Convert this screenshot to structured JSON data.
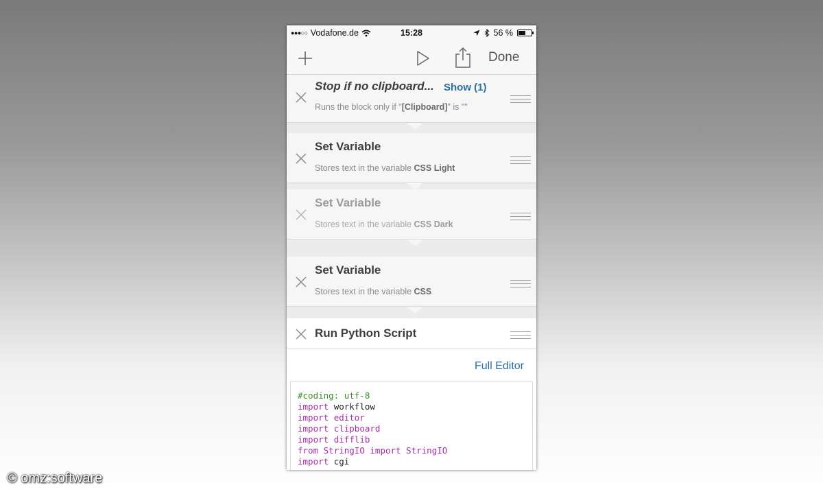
{
  "status_bar": {
    "signal": "●●●○○",
    "carrier": "Vodafone.de",
    "time": "15:28",
    "battery_text": "56 %",
    "battery_level": 0.56
  },
  "toolbar": {
    "add_icon": "plus-icon",
    "run_icon": "play-icon",
    "share_icon": "share-icon",
    "done_label": "Done"
  },
  "blocks": [
    {
      "title": "Stop if no clipboard...",
      "show_label": "Show (1)",
      "desc_pre": "Runs the block only if \"",
      "desc_bold": "[Clipboard]",
      "desc_post": "\" is \"\""
    },
    {
      "title": "Set Variable",
      "desc_pre": "Stores text in the variable ",
      "desc_bold": "CSS Light"
    },
    {
      "title": "Set Variable",
      "desc_pre": "Stores text in the variable ",
      "desc_bold": "CSS Dark"
    },
    {
      "title": "Set Variable",
      "desc_pre": "Stores text in the variable ",
      "desc_bold": "CSS"
    },
    {
      "title": "Run Python Script",
      "full_editor_label": "Full Editor"
    }
  ],
  "code": {
    "line1": "#coding: utf-8",
    "import_kw": "import",
    "from_kw": "from",
    "mod1": "workflow",
    "mod2": "editor",
    "mod3": "clipboard",
    "mod4": "difflib",
    "mod5_a": "StringIO",
    "mod5_b": "StringIO",
    "mod6": "cgi"
  },
  "watermark": "© omz:software"
}
